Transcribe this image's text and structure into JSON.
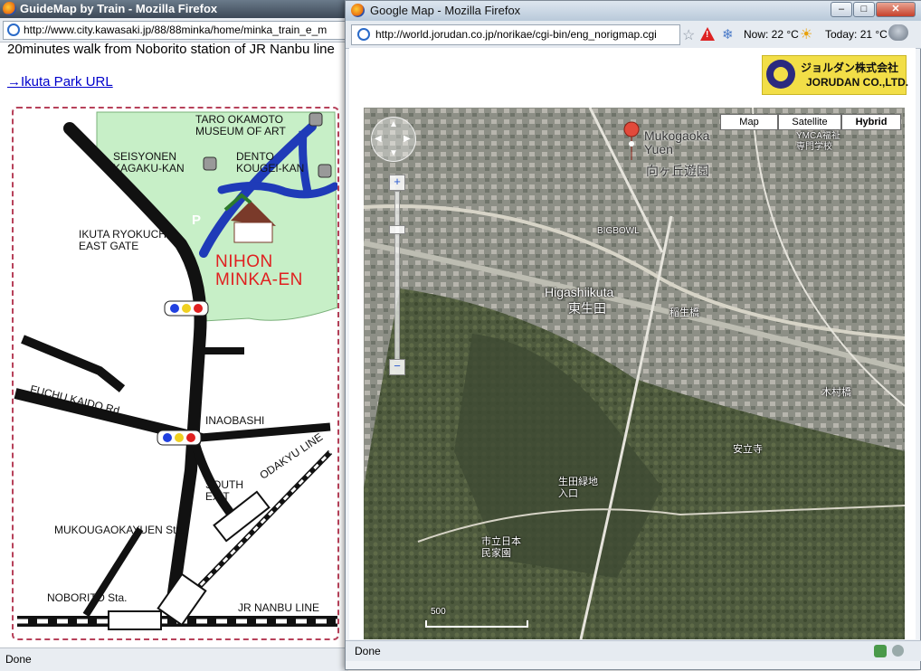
{
  "back_window": {
    "title": "GuideMap   by   Train - Mozilla Firefox",
    "url": "http://www.city.kawasaki.jp/88/88minka/home/minka_train_e_m",
    "text_line": "20minutes walk from Noborito station of JR Nanbu line",
    "park_link": "→Ikuta Park URL",
    "status": "Done",
    "guide_map": {
      "taro": "TARO OKAMOTO\nMUSEUM OF ART",
      "seisyonen": "SEISYONEN\nKAGAKU-KAN",
      "dento": "DENTO\nKOUGEI-KAN",
      "ryokuchi": "IKUTA RYOKUCHI\nEAST GATE",
      "parking": "P",
      "minka": "NIHON\nMINKA-EN",
      "fuchu": "FUCHU KAIDO Rd.",
      "inaobashi": "INAOBASHI",
      "odakyu": "ODAKYU LINE",
      "south_exit": "SOUTH\nEXIT",
      "mukouga": "MUKOUGAOKAYUEN Sta.",
      "noborito": "NOBORITO Sta.",
      "nanbu": "JR NANBU LINE"
    }
  },
  "front_window": {
    "title": "Google Map - Mozilla Firefox",
    "url": "http://world.jorudan.co.jp/norikae/cgi-bin/eng_norigmap.cgi",
    "weather_now": "Now: 22 °C",
    "weather_today": "Today: 21 °C",
    "logo_jp": "ジョルダン株式会社",
    "logo_en": "JORUDAN CO.,LTD.",
    "map_types": [
      "Map",
      "Satellite",
      "Hybrid"
    ],
    "selected_map_type": "Hybrid",
    "map_labels": {
      "muko_en": "Mukogaoka\nYuen",
      "muko_jp": "向ヶ丘遊園",
      "higashi_en": "Higashiikuta",
      "higashi_jp": "東生田",
      "ryokuchi_jp": "生田緑地\n入口",
      "minka_jp": "市立日本\n民家園",
      "inadabashi": "稲生橋",
      "kimurabashi": "木村橋",
      "annyoji": "安立寺",
      "ymca": "YMCA福祉\n専門学校",
      "bigbowl": "BIGBOWL",
      "scale": "500"
    },
    "status": "Done"
  }
}
